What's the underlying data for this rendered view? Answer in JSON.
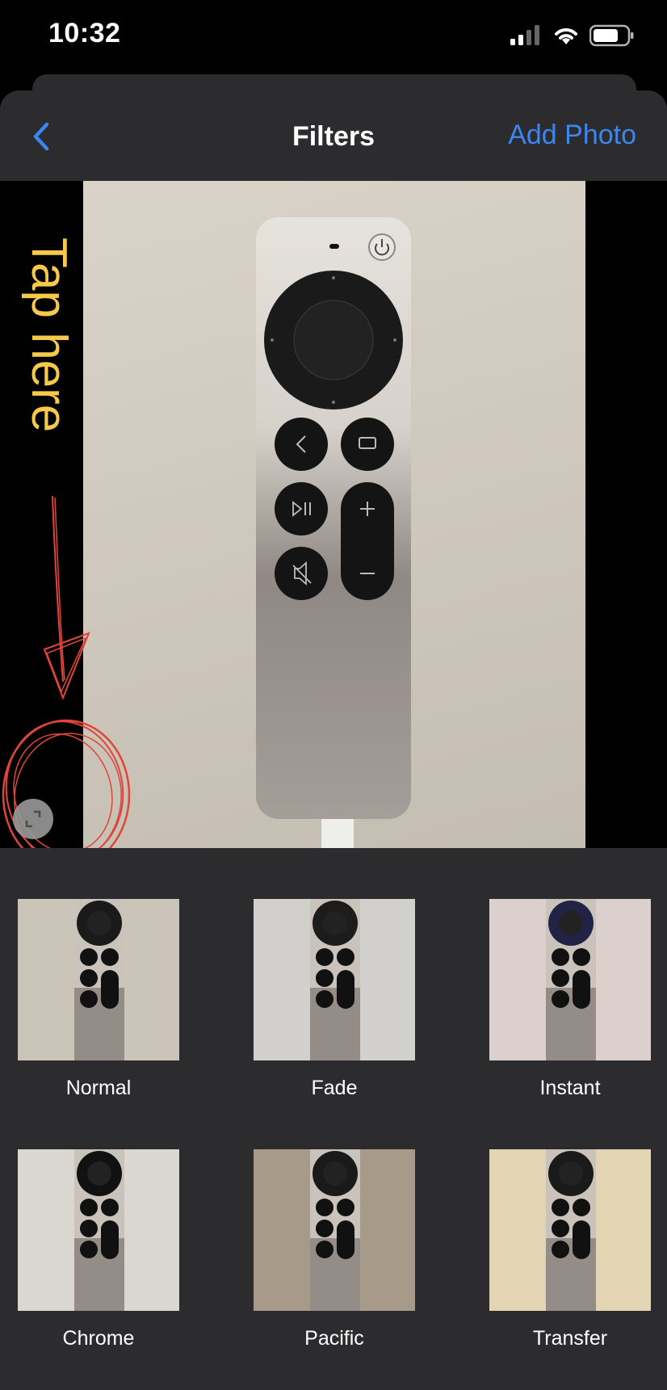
{
  "status": {
    "time": "10:32"
  },
  "nav": {
    "title": "Filters",
    "action": "Add Photo"
  },
  "annotation": {
    "text": "Tap here"
  },
  "filters": [
    {
      "label": "Normal",
      "bg": "#cbc4b8",
      "ring": "#1a1a1a"
    },
    {
      "label": "Fade",
      "bg": "#d2d0cc",
      "ring": "#1c1c1c"
    },
    {
      "label": "Instant",
      "bg": "#dcd0cc",
      "ring": "#222244"
    },
    {
      "label": "Chrome",
      "bg": "#d9d7cf",
      "ring": "#111111"
    },
    {
      "label": "Pacific",
      "bg": "#a89a88",
      "ring": "#1a1a1a"
    },
    {
      "label": "Transfer",
      "bg": "#e3d4b3",
      "ring": "#1a1a1a"
    }
  ],
  "colors": {
    "accent": "#3c86f0",
    "sheet": "#2c2c2e",
    "annotation_text": "#f5c94a",
    "annotation_ink": "#e0453a"
  }
}
